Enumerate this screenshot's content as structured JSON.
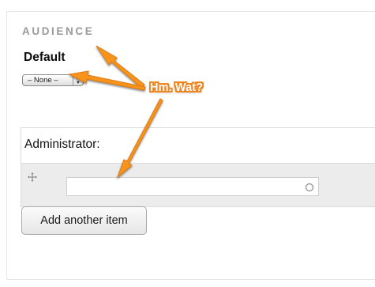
{
  "section": {
    "title": "AUDIENCE"
  },
  "default_field": {
    "label": "Default",
    "select_value": "– None –",
    "select_arrows_icon": "updown-arrows-icon"
  },
  "administrator_field": {
    "label": "Administrator:",
    "drag_handle_icon": "move-handle-icon",
    "input_value": "",
    "input_indicator_icon": "autocomplete-throbber-icon"
  },
  "actions": {
    "add_another_label": "Add another item"
  },
  "annotation": {
    "text": "Hm. Wat?",
    "arrow_color": "#f7941d",
    "outline_color": "#f0841f"
  }
}
